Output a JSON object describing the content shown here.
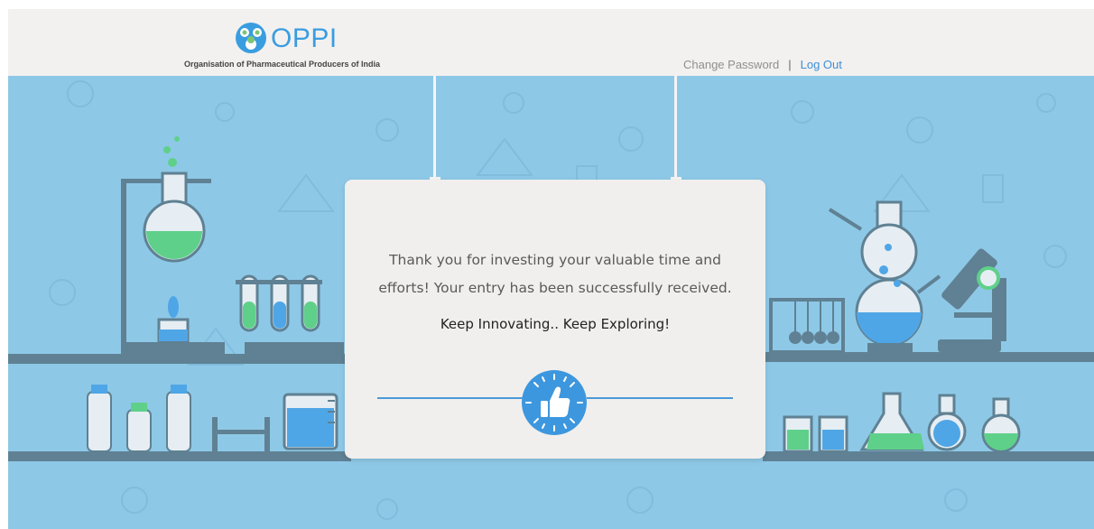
{
  "header": {
    "logo_text": "OPPI",
    "logo_subtitle": "Organisation of Pharmaceutical Producers of India",
    "nav": {
      "change_password": "Change Password",
      "separator": "|",
      "logout": "Log Out"
    }
  },
  "card": {
    "message_line1": "Thank you for investing your valuable time and",
    "message_line2": "efforts! Your entry has been successfully received.",
    "tagline": "Keep Innovating.. Keep Exploring!",
    "badge_icon": "thumbs-up-icon"
  },
  "colors": {
    "accent": "#3a9de0",
    "scene_bg": "#8ec8e7",
    "header_bg": "#f3f1ef",
    "card_bg": "#f1efed",
    "shelf": "#5f8193",
    "liquid_green": "#5fd08a",
    "liquid_blue": "#4fa6e6"
  }
}
